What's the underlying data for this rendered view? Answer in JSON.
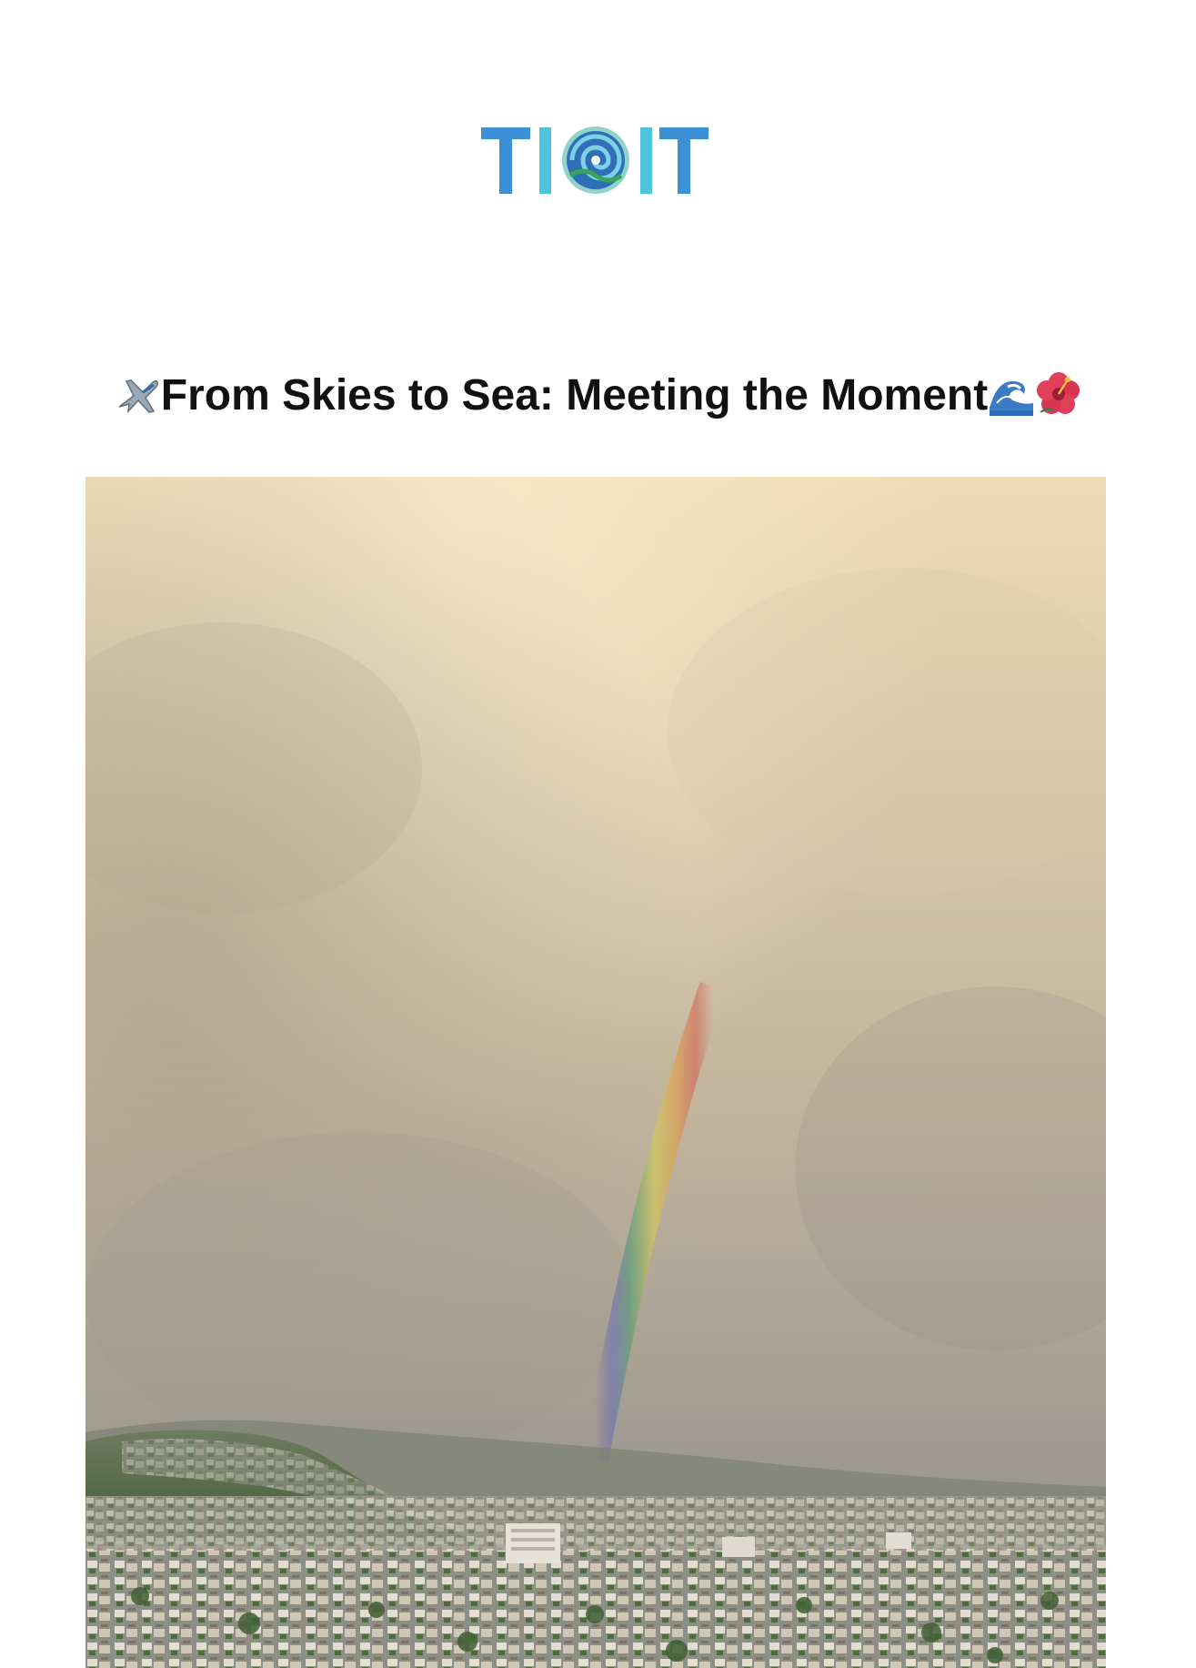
{
  "logo": {
    "text_left": "TI",
    "text_right": "IT",
    "icon": "swirl-wave-icon",
    "colors": {
      "primary": "#3d8fd6",
      "accent": "#4fc4d8",
      "swirl_blue": "#2f6fb8",
      "swirl_green": "#3aa35a"
    }
  },
  "article": {
    "title_prefix_icon": "airplane-icon",
    "title": "From Skies to Sea: Meeting the Moment",
    "title_suffix_icons": [
      "wave-icon",
      "hibiscus-icon"
    ]
  },
  "photo": {
    "subject": "rainbow-over-city-photo",
    "colors": {
      "sky_top": "#efdcb4",
      "sky_mid": "#c7b79d",
      "sky_low": "#9e998e",
      "hills": "#56684a",
      "city": "#b7b2a6"
    }
  }
}
